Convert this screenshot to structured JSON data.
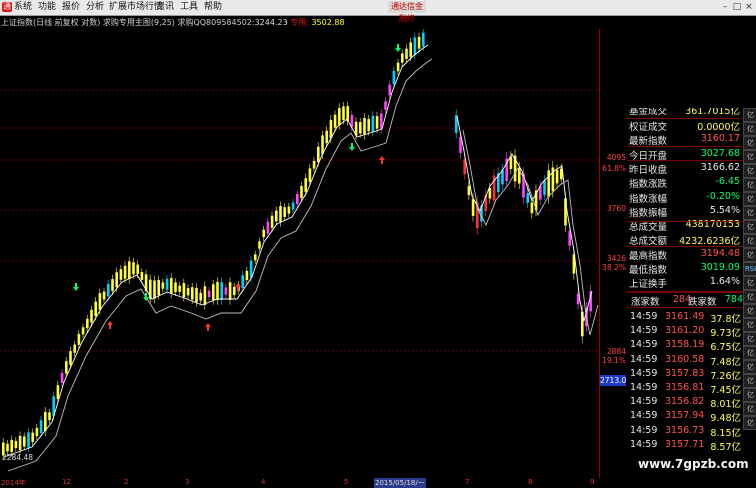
{
  "menu": {
    "items": [
      "系统",
      "功能",
      "报价",
      "分析",
      "扩展市场行情",
      "资讯",
      "工具",
      "帮助"
    ],
    "promo": "通达信金融终"
  },
  "title": {
    "main": "上证指数(日线 前复权 对数) 求购专用主图(9,25) 求购QQ809584502:",
    "value1": "3244.23",
    "label2": "专用:",
    "value2": "3502.88"
  },
  "axis": {
    "right_labels": [
      {
        "text": "4095",
        "pct": "61.8%"
      },
      {
        "text": "3760",
        "pct": ""
      },
      {
        "text": "3426",
        "pct": "38.2%"
      },
      {
        "text": "2884",
        "pct": "19.1%"
      }
    ],
    "current_price": "2713.0",
    "low_label": "2284.48",
    "x_labels": [
      "2014年",
      "12",
      "2",
      "3",
      "4",
      "5",
      "2015/05/18/一",
      "7",
      "8",
      "9"
    ]
  },
  "info": {
    "partial_top": {
      "key": "基金成交",
      "value": "361.7015亿"
    },
    "rows": [
      {
        "key": "权证成交",
        "value": "0.0000亿",
        "color": "#ffff55"
      },
      {
        "key": "最新指数",
        "value": "3160.17",
        "color": "#ff5050"
      },
      {
        "key": "今日开盘",
        "value": "3027.68",
        "color": "#00ff66"
      },
      {
        "key": "昨日收盘",
        "value": "3166.62",
        "color": "#e8e8e8"
      },
      {
        "key": "指数涨跌",
        "value": "-6.45",
        "color": "#00ff66"
      },
      {
        "key": "指数涨幅",
        "value": "-0.20%",
        "color": "#00ff66"
      },
      {
        "key": "指数振幅",
        "value": "5.54%",
        "color": "#e8e8e8"
      },
      {
        "key": "总成交量",
        "value": "438170153",
        "color": "#ffff55"
      },
      {
        "key": "总成交额",
        "value": "4232.6236亿",
        "color": "#ffff55"
      },
      {
        "key": "最高指数",
        "value": "3194.48",
        "color": "#ff5050"
      },
      {
        "key": "最低指数",
        "value": "3019.09",
        "color": "#00ff66"
      },
      {
        "key": "上证换手",
        "value": "1.64%",
        "color": "#e8e8e8"
      }
    ],
    "up_label": "涨家数",
    "up_count": "284",
    "down_label": "跌家数",
    "down_count": "784"
  },
  "ticks": [
    {
      "time": "14:59",
      "price": "3161.49",
      "vol": "37.8亿"
    },
    {
      "time": "14:59",
      "price": "3161.20",
      "vol": "9.73亿"
    },
    {
      "time": "14:59",
      "price": "3158.19",
      "vol": "6.75亿"
    },
    {
      "time": "14:59",
      "price": "3160.58",
      "vol": "7.48亿"
    },
    {
      "time": "14:59",
      "price": "3157.83",
      "vol": "7.26亿"
    },
    {
      "time": "14:59",
      "price": "3156.81",
      "vol": "7.45亿"
    },
    {
      "time": "14:59",
      "price": "3156.82",
      "vol": "8.01亿"
    },
    {
      "time": "14:59",
      "price": "3157.94",
      "vol": "9.48亿"
    },
    {
      "time": "14:59",
      "price": "3156.73",
      "vol": "8.15亿"
    },
    {
      "time": "14:59",
      "price": "3157.71",
      "vol": "8.57亿"
    }
  ],
  "side_tabs": [
    "亿",
    "亿",
    "亿",
    "亿",
    "亿",
    "亿",
    "亿",
    "亿",
    "亿",
    "亿",
    "亿",
    "RSI",
    "亿",
    "亿",
    "亿",
    "亿",
    "亿",
    "亿",
    "亿",
    "亿",
    "亿",
    "亿",
    "亿"
  ],
  "watermark": "www.7gpzb.com",
  "colors": {
    "up": "#ffff33",
    "down": "#00d0ff",
    "ma_fast": "#ffffff",
    "ma_slow": "#c0c0c0",
    "grid": "#7a0000",
    "axis_text": "#ff4040"
  }
}
